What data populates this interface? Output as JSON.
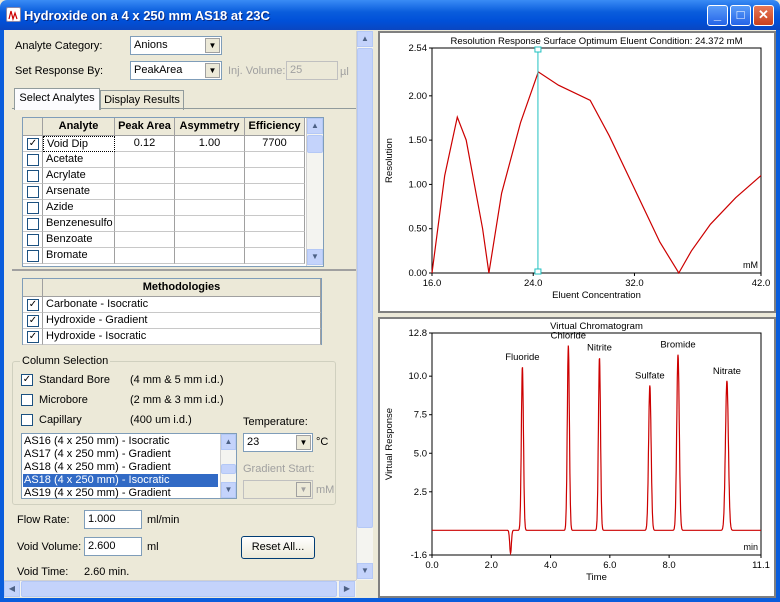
{
  "window": {
    "title": "Hydroxide on a 4 x 250 mm AS18 at 23C",
    "min": "_",
    "max": "□",
    "close": "✕"
  },
  "form": {
    "analyte_category_label": "Analyte Category:",
    "analyte_category_value": "Anions",
    "set_response_label": "Set Response By:",
    "set_response_value": "PeakArea",
    "inj_volume_label": "Inj. Volume:",
    "inj_volume_value": "25",
    "inj_volume_unit": "µl"
  },
  "tabs": [
    {
      "label": "Select Analytes"
    },
    {
      "label": "Display Results"
    }
  ],
  "analyte_table": {
    "headers": [
      "Analyte",
      "Peak Area",
      "Asymmetry",
      "Efficiency"
    ],
    "rows": [
      {
        "checked": true,
        "name": "Void Dip",
        "peak_area": "0.12",
        "asymmetry": "1.00",
        "efficiency": "7700"
      },
      {
        "checked": false,
        "name": "Acetate",
        "peak_area": "",
        "asymmetry": "",
        "efficiency": ""
      },
      {
        "checked": false,
        "name": "Acrylate",
        "peak_area": "",
        "asymmetry": "",
        "efficiency": ""
      },
      {
        "checked": false,
        "name": "Arsenate",
        "peak_area": "",
        "asymmetry": "",
        "efficiency": ""
      },
      {
        "checked": false,
        "name": "Azide",
        "peak_area": "",
        "asymmetry": "",
        "efficiency": ""
      },
      {
        "checked": false,
        "name": "Benzenesulfo",
        "peak_area": "",
        "asymmetry": "",
        "efficiency": ""
      },
      {
        "checked": false,
        "name": "Benzoate",
        "peak_area": "",
        "asymmetry": "",
        "efficiency": ""
      },
      {
        "checked": false,
        "name": "Bromate",
        "peak_area": "",
        "asymmetry": "",
        "efficiency": ""
      }
    ]
  },
  "methodologies": {
    "header": "Methodologies",
    "rows": [
      {
        "checked": true,
        "name": "Carbonate - Isocratic"
      },
      {
        "checked": true,
        "name": "Hydroxide - Gradient"
      },
      {
        "checked": true,
        "name": "Hydroxide - Isocratic"
      }
    ]
  },
  "column_selection": {
    "title": "Column Selection",
    "options": [
      {
        "checked": true,
        "label": "Standard Bore",
        "detail": "(4 mm & 5 mm i.d.)"
      },
      {
        "checked": false,
        "label": "Microbore",
        "detail": "(2 mm & 3 mm i.d.)"
      },
      {
        "checked": false,
        "label": "Capillary",
        "detail": "(400 um i.d.)"
      }
    ],
    "columns": [
      {
        "label": "AS16 (4 x 250 mm) - Isocratic",
        "selected": false
      },
      {
        "label": "AS17 (4 x 250 mm) - Gradient",
        "selected": false
      },
      {
        "label": "AS18 (4 x 250 mm) - Gradient",
        "selected": false
      },
      {
        "label": "AS18 (4 x 250 mm) - Isocratic",
        "selected": true
      },
      {
        "label": "AS19 (4 x 250 mm) - Gradient",
        "selected": false
      }
    ],
    "temperature_label": "Temperature:",
    "temperature_value": "23",
    "temperature_unit": "°C",
    "gradient_start_label": "Gradient Start:",
    "gradient_start_value": "",
    "gradient_start_unit": "mM"
  },
  "flow": {
    "label": "Flow Rate:",
    "value": "1.000",
    "unit": "ml/min"
  },
  "void_volume": {
    "label": "Void Volume:",
    "value": "2.600",
    "unit": "ml"
  },
  "void_time": {
    "label": "Void Time:",
    "value": "2.60 min."
  },
  "reset_button": "Reset All...",
  "chart_data": [
    {
      "type": "line",
      "title": "Resolution Response Surface  Optimum Eluent Condition: 24.372 mM",
      "xlabel": "Eluent Concentration",
      "ylabel": "Resolution",
      "x_unit": "mM",
      "xlim": [
        16.0,
        42.0
      ],
      "ylim": [
        0.0,
        2.54
      ],
      "xticks": [
        "16.0",
        "24.0",
        "32.0",
        "42.0"
      ],
      "yticks": [
        "0.00",
        "0.50",
        "1.00",
        "1.50",
        "2.00",
        "2.54"
      ],
      "optimum_x": 24.372,
      "series": [
        {
          "x": [
            16.0,
            17.0,
            18.0,
            18.7,
            20.0,
            20.5,
            21.5,
            23.0,
            24.4,
            26.0,
            28.5,
            30.0,
            32.0,
            34.0,
            35.5,
            36.5,
            38.0,
            40.0,
            42.0
          ],
          "y": [
            0.0,
            1.1,
            1.76,
            1.5,
            0.5,
            0.0,
            0.9,
            1.7,
            2.27,
            2.12,
            1.95,
            1.55,
            0.95,
            0.35,
            0.0,
            0.25,
            0.55,
            0.85,
            1.1
          ]
        }
      ],
      "grid": false,
      "legend": "none",
      "color": "#cc0000"
    },
    {
      "type": "line",
      "title": "Virtual Chromatogram",
      "xlabel": "Time",
      "ylabel": "Virtual Response",
      "x_unit": "min",
      "xlim": [
        0.0,
        11.1
      ],
      "ylim": [
        -1.6,
        12.8
      ],
      "xticks": [
        "0.0",
        "2.0",
        "4.0",
        "6.0",
        "8.0",
        "11.1"
      ],
      "yticks": [
        "-1.6",
        "2.5",
        "5.0",
        "7.5",
        "10.0",
        "12.8"
      ],
      "baseline": 0.0,
      "void_dip": {
        "time": 2.65,
        "depth": -1.5
      },
      "peaks": [
        {
          "name": "Fluoride",
          "time": 3.05,
          "height": 10.6,
          "width": 0.05
        },
        {
          "name": "Chloride",
          "time": 4.6,
          "height": 12.0,
          "width": 0.05
        },
        {
          "name": "Nitrite",
          "time": 5.65,
          "height": 11.2,
          "width": 0.05
        },
        {
          "name": "Sulfate",
          "time": 7.35,
          "height": 9.4,
          "width": 0.06
        },
        {
          "name": "Bromide",
          "time": 8.3,
          "height": 11.4,
          "width": 0.06
        },
        {
          "name": "Nitrate",
          "time": 9.95,
          "height": 9.7,
          "width": 0.07
        }
      ],
      "grid": false,
      "legend": "none",
      "color": "#cc0000"
    }
  ]
}
